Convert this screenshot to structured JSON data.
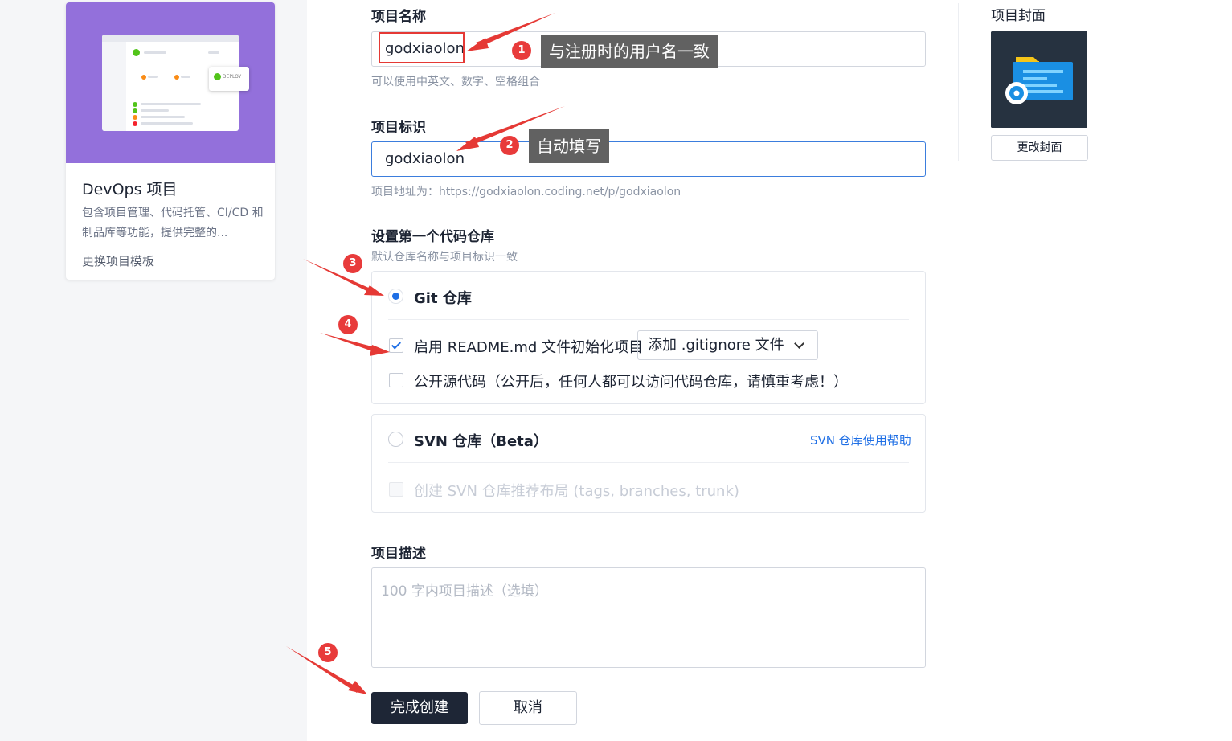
{
  "template_card": {
    "title": "DevOps 项目",
    "description": "包含项目管理、代码托管、CI/CD 和制品库等功能，提供完整的...",
    "change_link": "更换项目模板",
    "preview_badge": "DEPLOY",
    "preview_color": "#9370db"
  },
  "form": {
    "project_name": {
      "label": "项目名称",
      "value": "godxiaolon",
      "hint": "可以使用中英文、数字、空格组合"
    },
    "project_id": {
      "label": "项目标识",
      "value": "godxiaolon",
      "hint": "项目地址为：https://godxiaolon.coding.net/p/godxiaolon"
    },
    "repo_section": {
      "label": "设置第一个代码仓库",
      "hint": "默认仓库名称与项目标识一致",
      "git": {
        "title": "Git 仓库",
        "selected": true,
        "readme_label": "启用 README.md 文件初始化项目",
        "readme_checked": true,
        "gitignore_select": "添加 .gitignore 文件",
        "public_label": "公开源代码（公开后，任何人都可以访问代码仓库，请慎重考虑！）",
        "public_checked": false
      },
      "svn": {
        "title": "SVN 仓库（Beta）",
        "selected": false,
        "help_link": "SVN 仓库使用帮助",
        "layout_label": "创建 SVN 仓库推荐布局 (tags, branches, trunk)"
      }
    },
    "description": {
      "label": "项目描述",
      "placeholder": "100 字内项目描述（选填）"
    },
    "submit_label": "完成创建",
    "cancel_label": "取消"
  },
  "cover": {
    "label": "项目封面",
    "change_label": "更改封面"
  },
  "annotations": {
    "badges": [
      "1",
      "2",
      "3",
      "4",
      "5"
    ],
    "tip1": "与注册时的用户名一致",
    "tip2": "自动填写",
    "arrow_color": "#e53935"
  }
}
